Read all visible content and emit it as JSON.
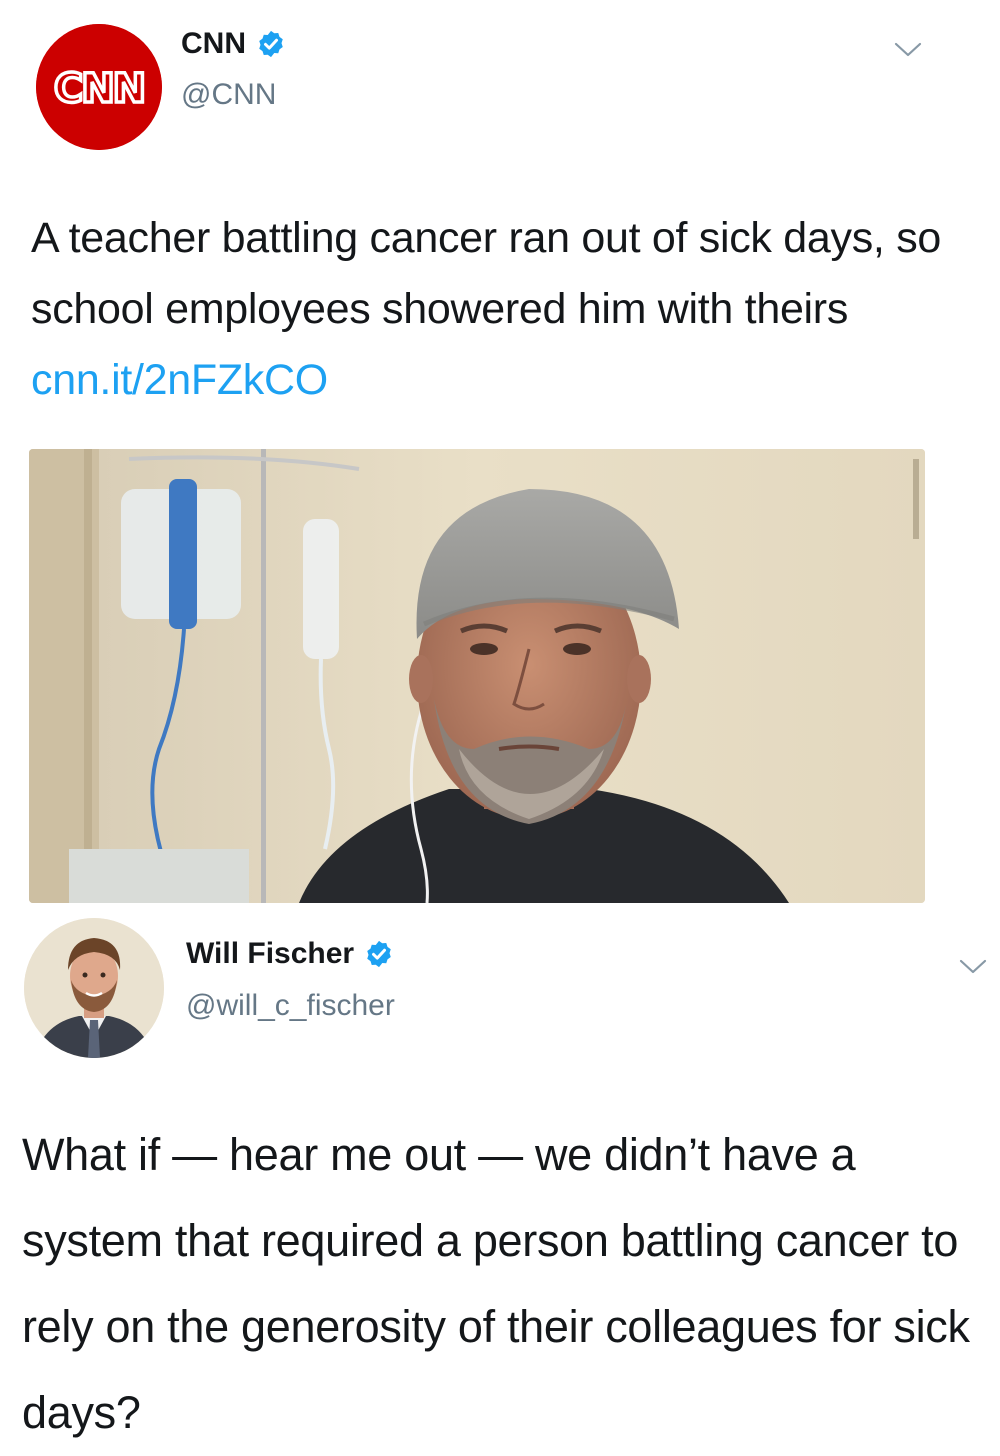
{
  "tweet1": {
    "display_name": "CNN",
    "handle": "@CNN",
    "avatar_text": "CNN",
    "text": "A teacher battling cancer ran out of sick days, so school employees showered him with theirs ",
    "link": "cnn.it/2nFZkCO",
    "verified_icon": "verified-badge-icon",
    "menu_icon": "chevron-down-icon"
  },
  "tweet2": {
    "display_name": "Will Fischer",
    "handle": "@will_c_fischer",
    "text": "What if — hear me out — we didn’t have a system that required a person battling cancer to rely on the generosity of their colleagues for sick days?",
    "verified_icon": "verified-badge-icon",
    "menu_icon": "chevron-down-icon"
  },
  "colors": {
    "link": "#1da1f2",
    "verified": "#1da1f2",
    "cnn_red": "#cc0000",
    "handle_gray": "#657786"
  }
}
